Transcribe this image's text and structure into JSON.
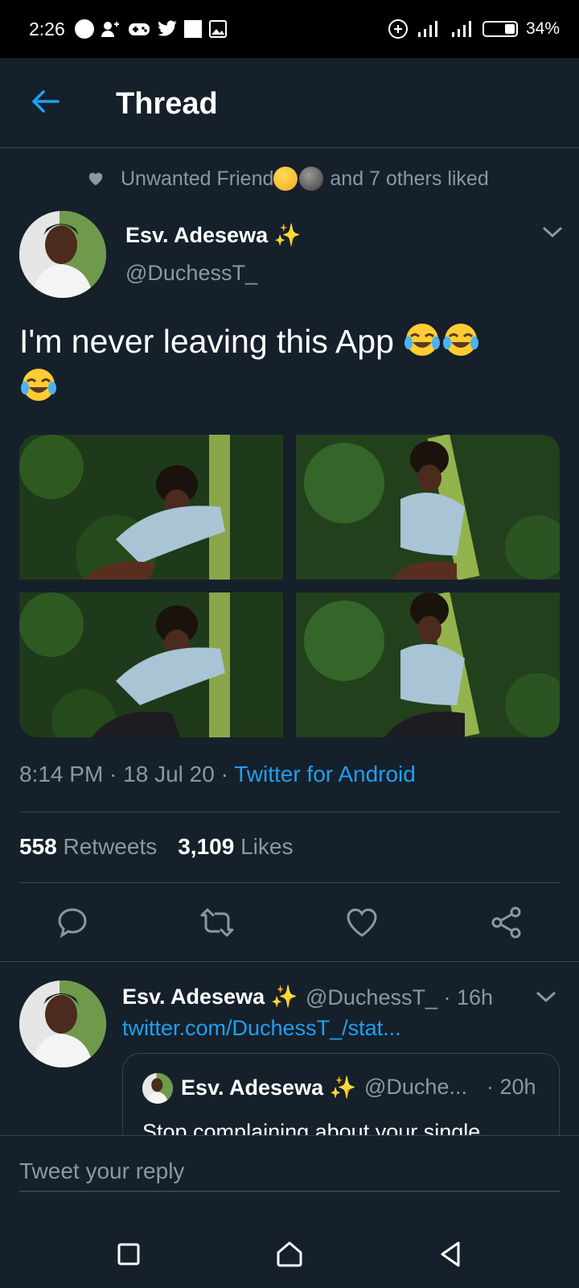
{
  "status_bar": {
    "time": "2:26",
    "battery": "34%",
    "battery_level": 0.34
  },
  "header": {
    "title": "Thread",
    "back_icon": "arrow-left-icon"
  },
  "social_context": {
    "text_before": "Unwanted Friend",
    "text_after": "and 7 others liked"
  },
  "tweet": {
    "author_name": "Esv. Adesewa",
    "author_handle": "@DuchessT_",
    "text": "I'm never leaving this App",
    "timestamp": "8:14 PM · 18 Jul 20 · ",
    "source": "Twitter for Android",
    "retweets_count": "558",
    "retweets_label": "Retweets",
    "likes_count": "3,109",
    "likes_label": "Likes",
    "actions": [
      "reply-icon",
      "retweet-icon",
      "like-icon",
      "share-icon"
    ]
  },
  "reply": {
    "author_name": "Esv. Adesewa",
    "handle_time": "@DuchessT_ · 16h",
    "link": "twitter.com/DuchessT_/stat...",
    "quote": {
      "author_name": "Esv. Adesewa",
      "handle": "@Duche...",
      "time": "· 20h",
      "text": "Stop complaining about your single"
    }
  },
  "compose": {
    "placeholder": "Tweet your reply"
  },
  "colors": {
    "background": "#15202b",
    "accent": "#1da1f2",
    "secondary_text": "#8899a6",
    "divider": "#38444d"
  }
}
